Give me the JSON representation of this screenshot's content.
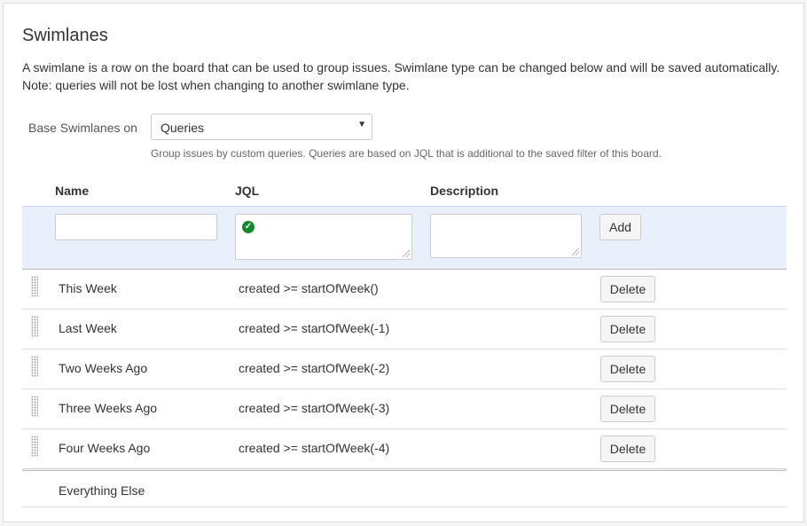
{
  "section": {
    "title": "Swimlanes",
    "description_line1": "A swimlane is a row on the board that can be used to group issues. Swimlane type can be changed below and will be saved automatically.",
    "description_line2": "Note: queries will not be lost when changing to another swimlane type."
  },
  "base": {
    "label": "Base Swimlanes on",
    "selected": "Queries",
    "helper": "Group issues by custom queries. Queries are based on JQL that is additional to the saved filter of this board."
  },
  "table": {
    "headers": {
      "name": "Name",
      "jql": "JQL",
      "description": "Description"
    },
    "new_row": {
      "name_value": "",
      "jql_value": "",
      "description_value": "",
      "add_label": "Add"
    },
    "rows": [
      {
        "name": "This Week",
        "jql": "created >= startOfWeek()",
        "delete_label": "Delete"
      },
      {
        "name": "Last Week",
        "jql": "created >= startOfWeek(-1)",
        "delete_label": "Delete"
      },
      {
        "name": "Two Weeks Ago",
        "jql": "created >= startOfWeek(-2)",
        "delete_label": "Delete"
      },
      {
        "name": "Three Weeks Ago",
        "jql": "created >= startOfWeek(-3)",
        "delete_label": "Delete"
      },
      {
        "name": "Four Weeks Ago",
        "jql": "created >= startOfWeek(-4)",
        "delete_label": "Delete"
      }
    ],
    "everything_else": "Everything Else"
  },
  "icons": {
    "valid": "check-circle-icon",
    "drag": "drag-handle-icon",
    "dropdown": "caret-down-icon"
  },
  "colors": {
    "valid_green": "#14892c",
    "new_row_bg": "#e9f0fb"
  }
}
